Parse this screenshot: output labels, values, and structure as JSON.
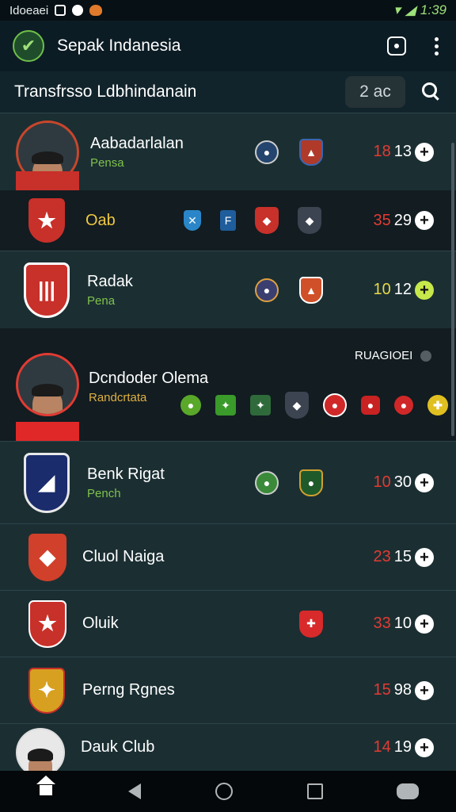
{
  "status": {
    "carrier": "Idoeaei",
    "time": "1:39"
  },
  "appbar": {
    "title": "Sepak Indanesia"
  },
  "subheader": {
    "title": "Transfrsso Ldbhindanain",
    "chip": "2 ac"
  },
  "rows": [
    {
      "name": "Aabadarlalan",
      "sub": "Pensa",
      "score_a": "18",
      "score_b": "13"
    },
    {
      "name": "Oab",
      "sub": "",
      "score_a": "35",
      "score_b": "29"
    },
    {
      "name": "Radak",
      "sub": "Pena",
      "score_a": "10",
      "score_b": "12"
    },
    {
      "name": "Dcndoder Olema",
      "sub": "Randcrtata",
      "tag": "RUAGIOEI",
      "score_a": "",
      "score_b": ""
    },
    {
      "name": "Benk Rigat",
      "sub": "Pench",
      "score_a": "10",
      "score_b": "30"
    },
    {
      "name": "Cluol Naiga",
      "sub": "",
      "score_a": "23",
      "score_b": "15"
    },
    {
      "name": "Oluik",
      "sub": "",
      "score_a": "33",
      "score_b": "10"
    },
    {
      "name": "Perng Rgnes",
      "sub": "",
      "score_a": "15",
      "score_b": "98"
    },
    {
      "name": "Dauk Club",
      "sub": "",
      "score_a": "14",
      "score_b": "19"
    }
  ],
  "colors": {
    "accent": "#7fc24b",
    "score_red": "#e23b32",
    "row_light": "#1b2f33",
    "row_dark": "#121c21"
  },
  "icons": [
    "wifi-icon",
    "signal-icon",
    "camera-icon",
    "more-icon",
    "search-icon",
    "add-icon",
    "home-icon",
    "back-icon",
    "recents-icon",
    "game-icon"
  ]
}
